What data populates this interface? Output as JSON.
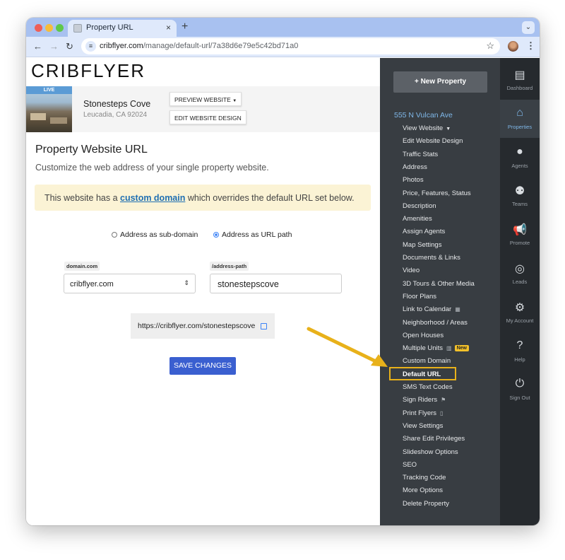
{
  "browser": {
    "tab_title": "Property URL",
    "new_tab_label": "+",
    "close_tab_label": "×",
    "tab_menu_label": "⌄",
    "url_host": "cribflyer.com",
    "url_path": "/manage/default-url/7a38d6e79e5c42bd71a0"
  },
  "app": {
    "logo": "CRIBFLYER"
  },
  "property": {
    "live_badge": "LIVE",
    "name": "Stonesteps Cove",
    "city": "Leucadia, CA 92024",
    "preview_button": "PREVIEW WEBSITE",
    "edit_button": "EDIT WEBSITE DESIGN"
  },
  "page": {
    "title": "Property Website URL",
    "subtitle": "Customize the web address of your single property website.",
    "notice_prefix": "This website has a ",
    "notice_link": "custom domain",
    "notice_suffix": " which overrides the default URL set below."
  },
  "form": {
    "radio_subdomain": "Address as sub-domain",
    "radio_path": "Address as URL path",
    "selected_mode": "path",
    "domain_label": "domain.com",
    "domain_value": "cribflyer.com",
    "path_label": "/address-path",
    "path_value": "stonestepscove",
    "preview_url": "https://cribflyer.com/stonestepscove",
    "save_label": "SAVE CHANGES"
  },
  "sidebar": {
    "new_property": "New Property",
    "address": "555 N Vulcan Ave",
    "items": [
      {
        "label": "View Website",
        "extra": "caret"
      },
      {
        "label": "Edit Website Design"
      },
      {
        "label": "Traffic Stats"
      },
      {
        "label": "Address"
      },
      {
        "label": "Photos"
      },
      {
        "label": "Price, Features, Status"
      },
      {
        "label": "Description"
      },
      {
        "label": "Amenities"
      },
      {
        "label": "Assign Agents"
      },
      {
        "label": "Map Settings"
      },
      {
        "label": "Documents & Links"
      },
      {
        "label": "Video"
      },
      {
        "label": "3D Tours & Other Media"
      },
      {
        "label": "Floor Plans"
      },
      {
        "label": "Link to Calendar",
        "extra": "calendar-icon"
      },
      {
        "label": "Neighborhood / Areas"
      },
      {
        "label": "Open Houses"
      },
      {
        "label": "Multiple Units",
        "extra": "building-icon",
        "badge": "New"
      },
      {
        "label": "Custom Domain"
      },
      {
        "label": "Default URL",
        "active": true
      },
      {
        "label": "SMS Text Codes"
      },
      {
        "label": "Sign Riders",
        "extra": "sign-icon"
      },
      {
        "label": "Print Flyers",
        "extra": "flyer-icon"
      },
      {
        "label": "View Settings"
      },
      {
        "label": "Share Edit Privileges"
      },
      {
        "label": "Slideshow Options"
      },
      {
        "label": "SEO"
      },
      {
        "label": "Tracking Code"
      },
      {
        "label": "More Options"
      },
      {
        "label": "Delete Property"
      }
    ]
  },
  "rail": {
    "items": [
      {
        "label": "Dashboard",
        "icon": "dashboard-icon",
        "glyph": "▤"
      },
      {
        "label": "Properties",
        "icon": "properties-icon",
        "glyph": "⌂",
        "active": true
      },
      {
        "label": "Agents",
        "icon": "agent-icon",
        "glyph": "●"
      },
      {
        "label": "Teams",
        "icon": "teams-icon",
        "glyph": "⚉"
      },
      {
        "label": "Promote",
        "icon": "megaphone-icon",
        "glyph": "📢"
      },
      {
        "label": "Leads",
        "icon": "target-icon",
        "glyph": "◎"
      },
      {
        "label": "My Account",
        "icon": "gear-icon",
        "glyph": "⚙"
      },
      {
        "label": "Help",
        "icon": "help-icon",
        "glyph": "?"
      },
      {
        "label": "Sign Out",
        "icon": "power-icon",
        "glyph": "⏻"
      }
    ]
  },
  "colors": {
    "accent": "#3a5fd0",
    "sidebar": "#383d42",
    "rail": "#262a2e",
    "highlight": "#e8b11a",
    "notice_bg": "#fbf3d5"
  }
}
